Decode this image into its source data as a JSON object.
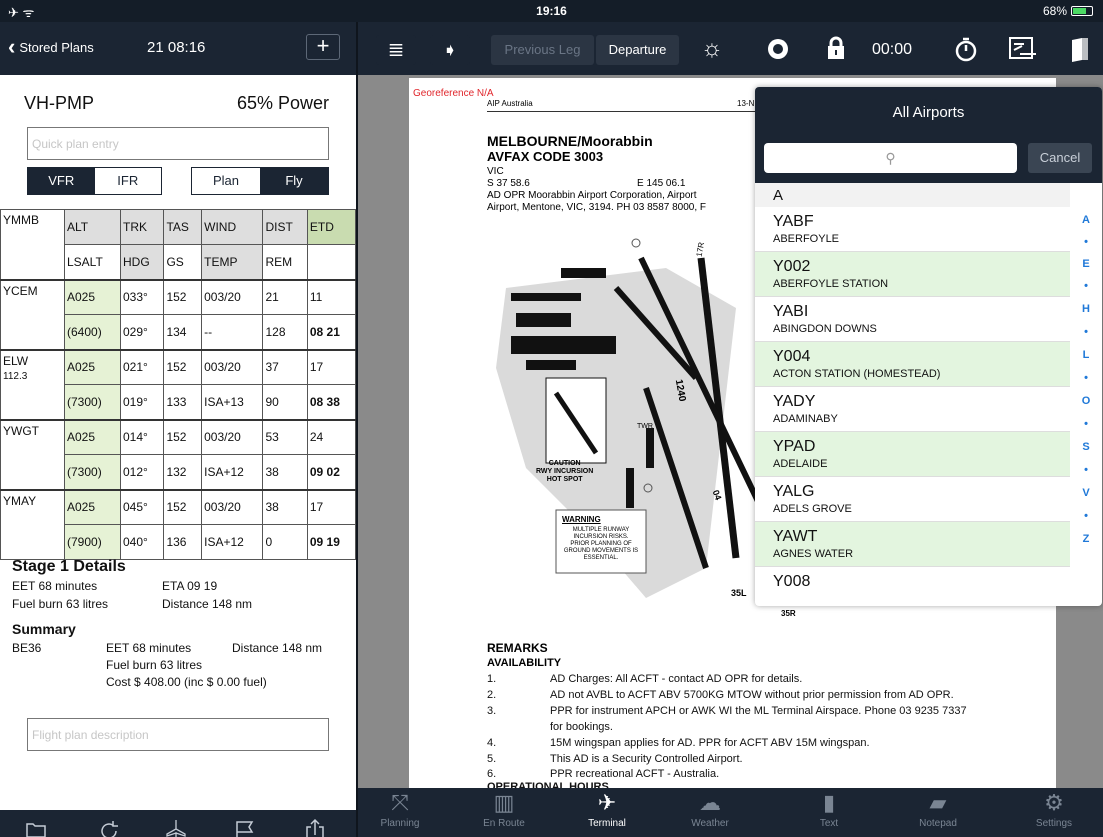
{
  "status": {
    "time": "19:16",
    "battery": "68%",
    "left_icons": "✈ ᯤ"
  },
  "left": {
    "nav": {
      "back_label": "Stored Plans",
      "time": "21 08:16",
      "add": "+"
    },
    "aircraft": "VH-PMP",
    "power": "65% Power",
    "quick_entry_placeholder": "Quick plan entry",
    "seg1": [
      "VFR",
      "IFR"
    ],
    "seg2": [
      "Plan",
      "Fly"
    ],
    "headers": {
      "wp": "YMMB",
      "row1": [
        "ALT",
        "TRK",
        "TAS",
        "WIND",
        "DIST",
        "ETD"
      ],
      "row2": [
        "LSALT",
        "HDG",
        "GS",
        "TEMP",
        "REM",
        ""
      ]
    },
    "legs": [
      {
        "wp": "YCEM",
        "wp2": "",
        "row1": [
          "A025",
          "033°",
          "152",
          "003/20",
          "21",
          "11"
        ],
        "row2": [
          "(6400)",
          "029°",
          "134",
          "--",
          "128",
          "08 21"
        ]
      },
      {
        "wp": "ELW",
        "wp2": "112.3",
        "row1": [
          "A025",
          "021°",
          "152",
          "003/20",
          "37",
          "17"
        ],
        "row2": [
          "(7300)",
          "019°",
          "133",
          "ISA+13",
          "90",
          "08 38"
        ]
      },
      {
        "wp": "YWGT",
        "wp2": "",
        "row1": [
          "A025",
          "014°",
          "152",
          "003/20",
          "53",
          "24"
        ],
        "row2": [
          "(7300)",
          "012°",
          "132",
          "ISA+12",
          "38",
          "09 02"
        ]
      },
      {
        "wp": "YMAY",
        "wp2": "",
        "row1": [
          "A025",
          "045°",
          "152",
          "003/20",
          "38",
          "17"
        ],
        "row2": [
          "(7900)",
          "040°",
          "136",
          "ISA+12",
          "0",
          "09 19"
        ]
      }
    ],
    "stage": {
      "title": "Stage 1 Details",
      "eet": "EET 68 minutes",
      "eta": "ETA 09 19",
      "fuel": "Fuel burn 63 litres",
      "distance": "Distance 148 nm"
    },
    "summary": {
      "title": "Summary",
      "type": "BE36",
      "eet": "EET 68 minutes",
      "distance": "Distance 148 nm",
      "fuel": "Fuel burn 63 litres",
      "cost": "Cost $ 408.00 (inc $ 0.00 fuel)"
    },
    "desc_placeholder": "Flight plan description"
  },
  "toolbar": {
    "prev_leg": "Previous Leg",
    "departure": "Departure",
    "timer": "00:00"
  },
  "doc": {
    "georef": "Georeference N/A",
    "source": "AIP Australia",
    "date_frag": "13-N",
    "title": "MELBOURNE/Moorabbin",
    "avfax": "AVFAX CODE 3003",
    "state": "VIC",
    "lat": "S 37 58.6",
    "lon": "E 145 06.1",
    "opr1": "AD OPR Moorabbin Airport Corporation, Airport",
    "opr2": "Airport, Mentone, VIC, 3194. PH 03 8587 8000, F",
    "caution": "CAUTION\nRWY INCURSION\nHOT SPOT",
    "warning_title": "WARNING",
    "warning_body": "MULTIPLE RUNWAY INCURSION RISKS.\nPRIOR PLANNING OF GROUND MOVEMENTS IS ESSENTIAL.",
    "rwy_1240": "1240",
    "rwy_35l": "35L",
    "rwy_35r": "35R",
    "rwy_04": "04",
    "rwy_17r": "17R",
    "twr": "TWR",
    "remarks": "REMARKS",
    "availability": "AVAILABILITY",
    "items": [
      {
        "n": "1.",
        "t": "AD Charges: All ACFT - contact AD OPR for details."
      },
      {
        "n": "2.",
        "t": "AD not AVBL to ACFT ABV 5700KG MTOW without prior permission from AD OPR."
      },
      {
        "n": "3.",
        "t": "PPR for instrument APCH or AWK WI the ML Terminal Airspace. Phone 03 9235 7337"
      },
      {
        "n": "",
        "t": "for bookings."
      },
      {
        "n": "4.",
        "t": "15M wingspan applies for AD. PPR for ACFT ABV 15M wingspan."
      },
      {
        "n": "5.",
        "t": "This AD is a Security Controlled Airport."
      },
      {
        "n": "6.",
        "t": "PPR recreational ACFT - Australia."
      }
    ],
    "cut": "OPERATIONAL HOURS"
  },
  "popover": {
    "title": "All Airports",
    "search_placeholder": "",
    "cancel": "Cancel",
    "section": "A",
    "airports": [
      {
        "code": "YABF",
        "name": "ABERFOYLE",
        "green": false
      },
      {
        "code": "Y002",
        "name": "ABERFOYLE STATION",
        "green": true
      },
      {
        "code": "YABI",
        "name": "ABINGDON DOWNS",
        "green": false
      },
      {
        "code": "Y004",
        "name": "ACTON STATION (HOMESTEAD)",
        "green": true
      },
      {
        "code": "YADY",
        "name": "ADAMINABY",
        "green": false
      },
      {
        "code": "YPAD",
        "name": "ADELAIDE",
        "green": true
      },
      {
        "code": "YALG",
        "name": "ADELS GROVE",
        "green": false
      },
      {
        "code": "YAWT",
        "name": "AGNES WATER",
        "green": true
      },
      {
        "code": "Y008",
        "name": "",
        "green": false
      }
    ],
    "index": [
      "A",
      "•",
      "E",
      "•",
      "H",
      "•",
      "L",
      "•",
      "O",
      "•",
      "S",
      "•",
      "V",
      "•",
      "Z"
    ]
  },
  "tabs": [
    {
      "label": "Planning",
      "icon": "planning-icon",
      "selected": false
    },
    {
      "label": "En Route",
      "icon": "map-icon",
      "selected": false
    },
    {
      "label": "Terminal",
      "icon": "airplane-icon",
      "selected": true
    },
    {
      "label": "Weather",
      "icon": "weather-icon",
      "selected": false
    },
    {
      "label": "Text",
      "icon": "book-icon",
      "selected": false
    },
    {
      "label": "Notepad",
      "icon": "notepad-icon",
      "selected": false
    },
    {
      "label": "Settings",
      "icon": "gear-icon",
      "selected": false
    }
  ],
  "colors": {
    "navy": "#1b2533",
    "green_cell": "#e6f2d5",
    "green_row": "#e3f5df",
    "header_green": "#c9dcb0",
    "link_blue": "#2079d8",
    "georef_red": "#e0262c"
  }
}
